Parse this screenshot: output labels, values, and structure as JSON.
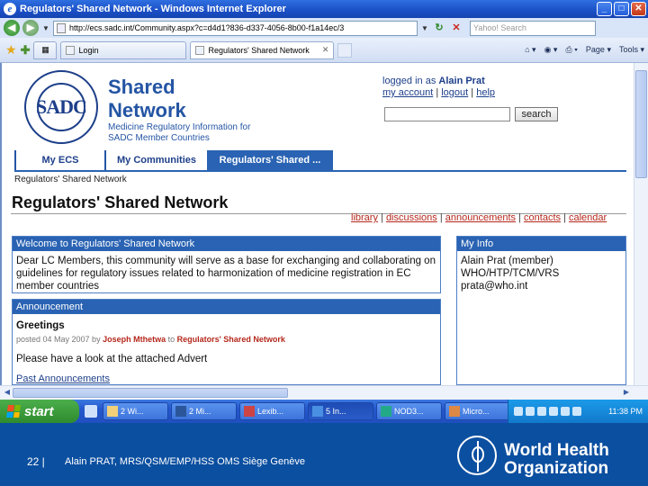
{
  "window": {
    "title": "Regulators' Shared Network - Windows Internet Explorer",
    "min": "_",
    "max": "□",
    "close": "✕"
  },
  "address": {
    "url": "http://ecs.sadc.int/Community.aspx?c=d4d1?836-d337-4056-8b00-f1a14ec/3",
    "search_placeholder": "Yahoo! Search"
  },
  "tabs": {
    "items": [
      {
        "label": "Login"
      },
      {
        "label": "Regulators' Shared Network"
      }
    ],
    "commands": [
      "Page ▾",
      "Tools ▾"
    ]
  },
  "site": {
    "logo_text": "SADC",
    "title_line1": "Shared",
    "title_line2": "Network",
    "subtitle": "Medicine Regulatory Information for SADC Member Countries",
    "logged_in_prefix": "logged in as",
    "user_name": "Alain Prat",
    "links": {
      "account": "my account",
      "logout": "logout",
      "help": "help",
      "sep": "|"
    },
    "search_button": "search",
    "nav": [
      {
        "label": "My ECS"
      },
      {
        "label": "My Communities"
      },
      {
        "label": "Regulators' Shared ..."
      }
    ],
    "breadcrumb": "Regulators' Shared Network"
  },
  "page": {
    "title": "Regulators' Shared Network",
    "tools": {
      "library": "library",
      "discussions": "discussions",
      "announcements": "announcements",
      "contacts": "contacts",
      "calendar": "calendar",
      "sep": "|"
    },
    "welcome": {
      "heading": "Welcome to Regulators' Shared Network",
      "body": "Dear LC Members, this community will serve as a base for exchanging and collaborating on guidelines for regulatory issues related to harmonization of medicine registration in EC member countries"
    },
    "myinfo": {
      "heading": "My Info",
      "line1": "Alain Prat (member)",
      "line2": "WHO/HTP/TCM/VRS",
      "line3": "prata@who.int"
    },
    "announcement": {
      "heading": "Announcement",
      "title": "Greetings",
      "posted_prefix": "posted 04 May 2007 by",
      "posted_by": "Joseph Mthetwa",
      "posted_mid": "to",
      "posted_to": "Regulators' Shared Network",
      "body": "Please have a look at the attached Advert",
      "past_link": "Past Announcements"
    }
  },
  "taskbar": {
    "start": "start",
    "buttons": [
      {
        "label": "2 Wi..."
      },
      {
        "label": "2 Mi..."
      },
      {
        "label": "Lexib..."
      },
      {
        "label": "5 In..."
      },
      {
        "label": "NOD3..."
      },
      {
        "label": "Micro..."
      }
    ],
    "clock": "11:38 PM"
  },
  "footer": {
    "slide_number": "22 |",
    "caption": "Alain PRAT, MRS/QSM/EMP/HSS OMS Siège Genève",
    "org_line1": "World Health",
    "org_line2": "Organization"
  },
  "colors": {
    "accent": "#2a63b3",
    "link_red": "#b5281c",
    "footer_blue": "#0b4fa0",
    "title_blue": "#2455a4"
  }
}
